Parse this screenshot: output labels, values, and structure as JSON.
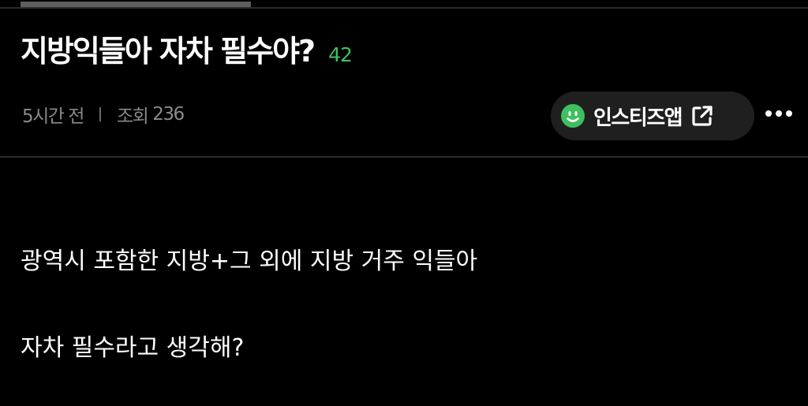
{
  "post": {
    "title": "지방익들아 자차 필수야?",
    "comment_count": "42",
    "time_ago": "5시간 전",
    "views_label": "조회",
    "views_count": "236",
    "body_lines": [
      "광역시 포함한 지방+그 외에 지방 거주 익들아",
      "자차 필수라고 생각해?"
    ]
  },
  "app_button": {
    "label": "인스티즈앱",
    "icon": "smile-icon",
    "link_icon": "external-link-icon"
  },
  "more_button": {
    "icon": "more-dots-icon"
  },
  "colors": {
    "background": "#000000",
    "accent_green": "#3fbf5f",
    "meta_gray": "#8a8a8a",
    "pill_bg": "#1f1f1f",
    "divider": "#2a2a2a"
  }
}
